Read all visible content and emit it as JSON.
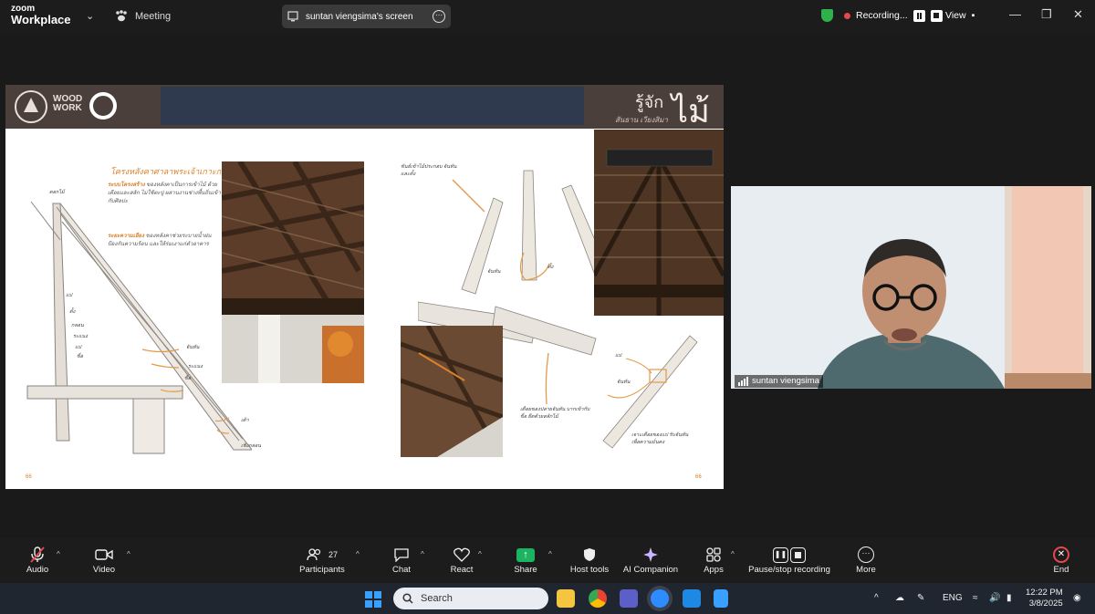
{
  "app": {
    "brand_line1": "zoom",
    "brand_line2": "Workplace",
    "meeting_label": "Meeting"
  },
  "share": {
    "label": "suntan viengsima's screen"
  },
  "recording": {
    "label": "Recording..."
  },
  "view": {
    "label": "View"
  },
  "slide": {
    "logo_text": "WOOD WORK",
    "header_title": "รู้จัก",
    "header_big": "ไม้",
    "header_sub": "สันธาน เวียงสิมา",
    "section_heading": "โครงหลังคาศาลาพระเจ้าเกาะกลาง",
    "page_left": "66",
    "page_right": "66"
  },
  "video": {
    "participant_name": "suntan viengsima"
  },
  "toolbar": {
    "audio": "Audio",
    "video": "Video",
    "participants": "Participants",
    "participants_count": "27",
    "chat": "Chat",
    "react": "React",
    "share": "Share",
    "host_tools": "Host tools",
    "ai_companion": "AI Companion",
    "apps": "Apps",
    "pause_stop": "Pause/stop recording",
    "more": "More",
    "end": "End"
  },
  "taskbar": {
    "search_placeholder": "Search",
    "lang": "ENG",
    "time": "12:22 PM",
    "date": "3/8/2025"
  },
  "colors": {
    "share_green": "#1bb561",
    "end_red": "#e5484d",
    "shield_green": "#2fb24c"
  }
}
